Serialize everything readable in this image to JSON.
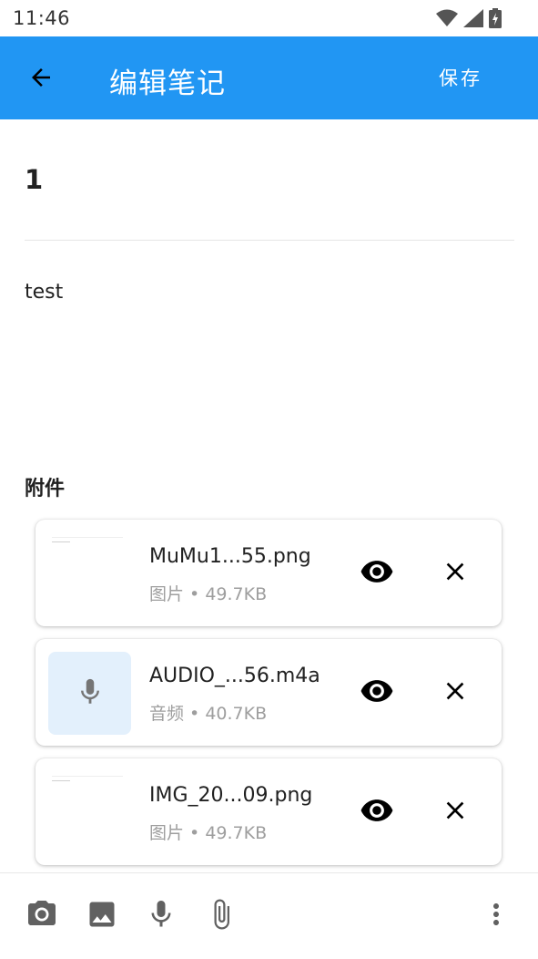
{
  "status_bar": {
    "time": "11:46"
  },
  "appbar": {
    "title": "编辑笔记",
    "save_label": "保存",
    "color": "#2196f3"
  },
  "note": {
    "title": "1",
    "body": "test"
  },
  "attachments": {
    "heading": "附件",
    "items": [
      {
        "name": "MuMu1...55.png",
        "type": "图片",
        "size": "49.7KB",
        "kind": "image"
      },
      {
        "name": "AUDIO_...56.m4a",
        "type": "音频",
        "size": "40.7KB",
        "kind": "audio"
      },
      {
        "name": "IMG_20...09.png",
        "type": "图片",
        "size": "49.7KB",
        "kind": "image"
      }
    ],
    "separator": " • "
  },
  "toolbar": {
    "icons": [
      "camera-icon",
      "image-icon",
      "mic-icon",
      "attach-icon",
      "more-vert-icon"
    ]
  }
}
